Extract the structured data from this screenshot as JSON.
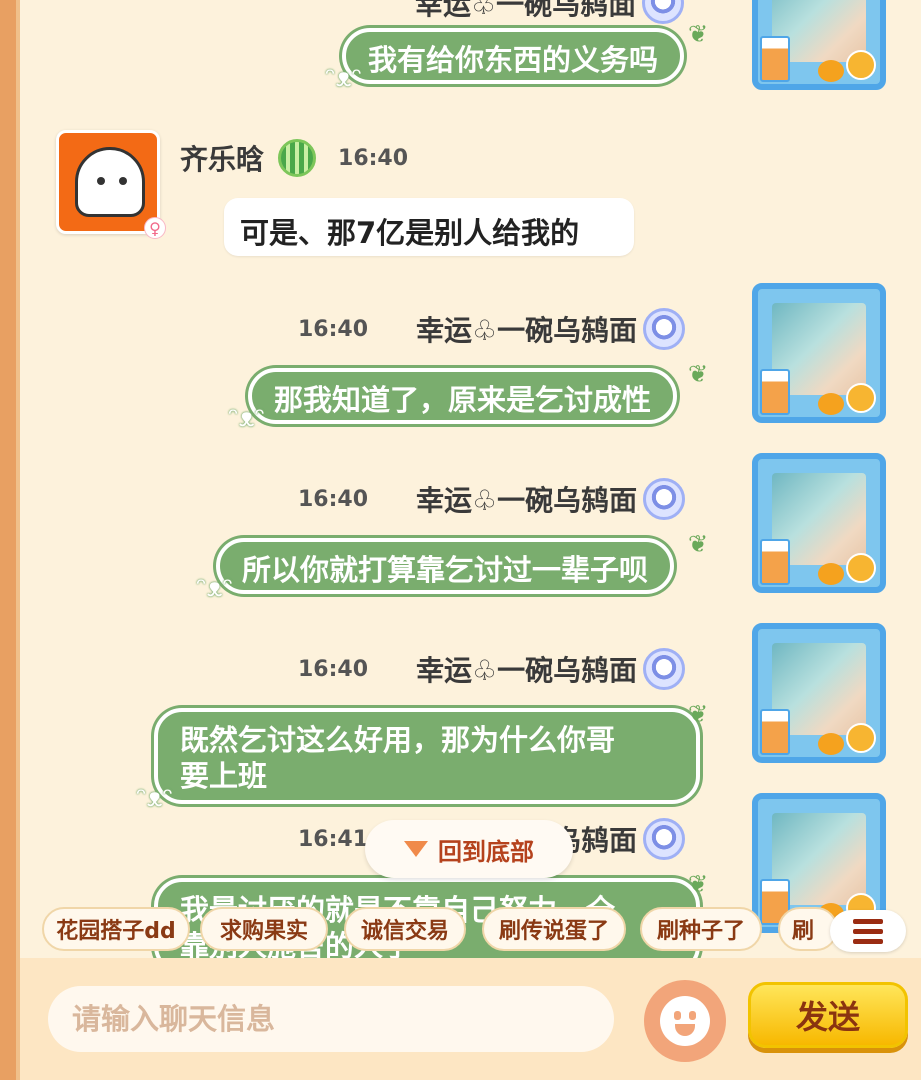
{
  "messages": [
    {
      "id": "m0",
      "sender": "幸运♧一碗乌鸫面",
      "time": "",
      "text": "我有给你东西的义务吗",
      "self": true
    },
    {
      "id": "m1",
      "sender": "齐乐晗",
      "time": "16:40",
      "text": "可是、那7亿是别人给我的",
      "self": false
    },
    {
      "id": "m2",
      "sender": "幸运♧一碗乌鸫面",
      "time": "16:40",
      "text": "那我知道了，原来是乞讨成性",
      "self": true
    },
    {
      "id": "m3",
      "sender": "幸运♧一碗乌鸫面",
      "time": "16:40",
      "text": "所以你就打算靠乞讨过一辈子呗",
      "self": true
    },
    {
      "id": "m4",
      "sender": "幸运♧一碗乌鸫面",
      "time": "16:40",
      "text_line1": "既然乞讨这么好用，那为什么你哥",
      "text_line2": "要上班",
      "self": true
    },
    {
      "id": "m5",
      "sender": "幸运♧一碗乌鸫面",
      "time": "16:41",
      "text_line1": "我最讨厌的就是不靠自己努力，全",
      "text_line2": "靠别人施舍的人了",
      "self": true
    }
  ],
  "back_to_bottom": {
    "label": "回到底部"
  },
  "quick_chips": [
    "花园搭子dd",
    "求购果实",
    "诚信交易",
    "刷传说蛋了",
    "刷种子了",
    "刷"
  ],
  "input": {
    "placeholder": "请输入聊天信息",
    "value": ""
  },
  "send_button": {
    "label": "发送"
  },
  "icons": {
    "emoji": "smiley-face-icon",
    "menu": "list-menu-icon",
    "back_arrow": "triangle-down-icon",
    "badge_self": "blue-crown-badge-icon",
    "badge_other": "green-stripe-badge-icon",
    "gender": "female-icon"
  },
  "colors": {
    "bubble_self": "#7aad6e",
    "background": "#fdf2dc",
    "send_button": "#f7b800",
    "chip_text": "#8a3a14"
  }
}
